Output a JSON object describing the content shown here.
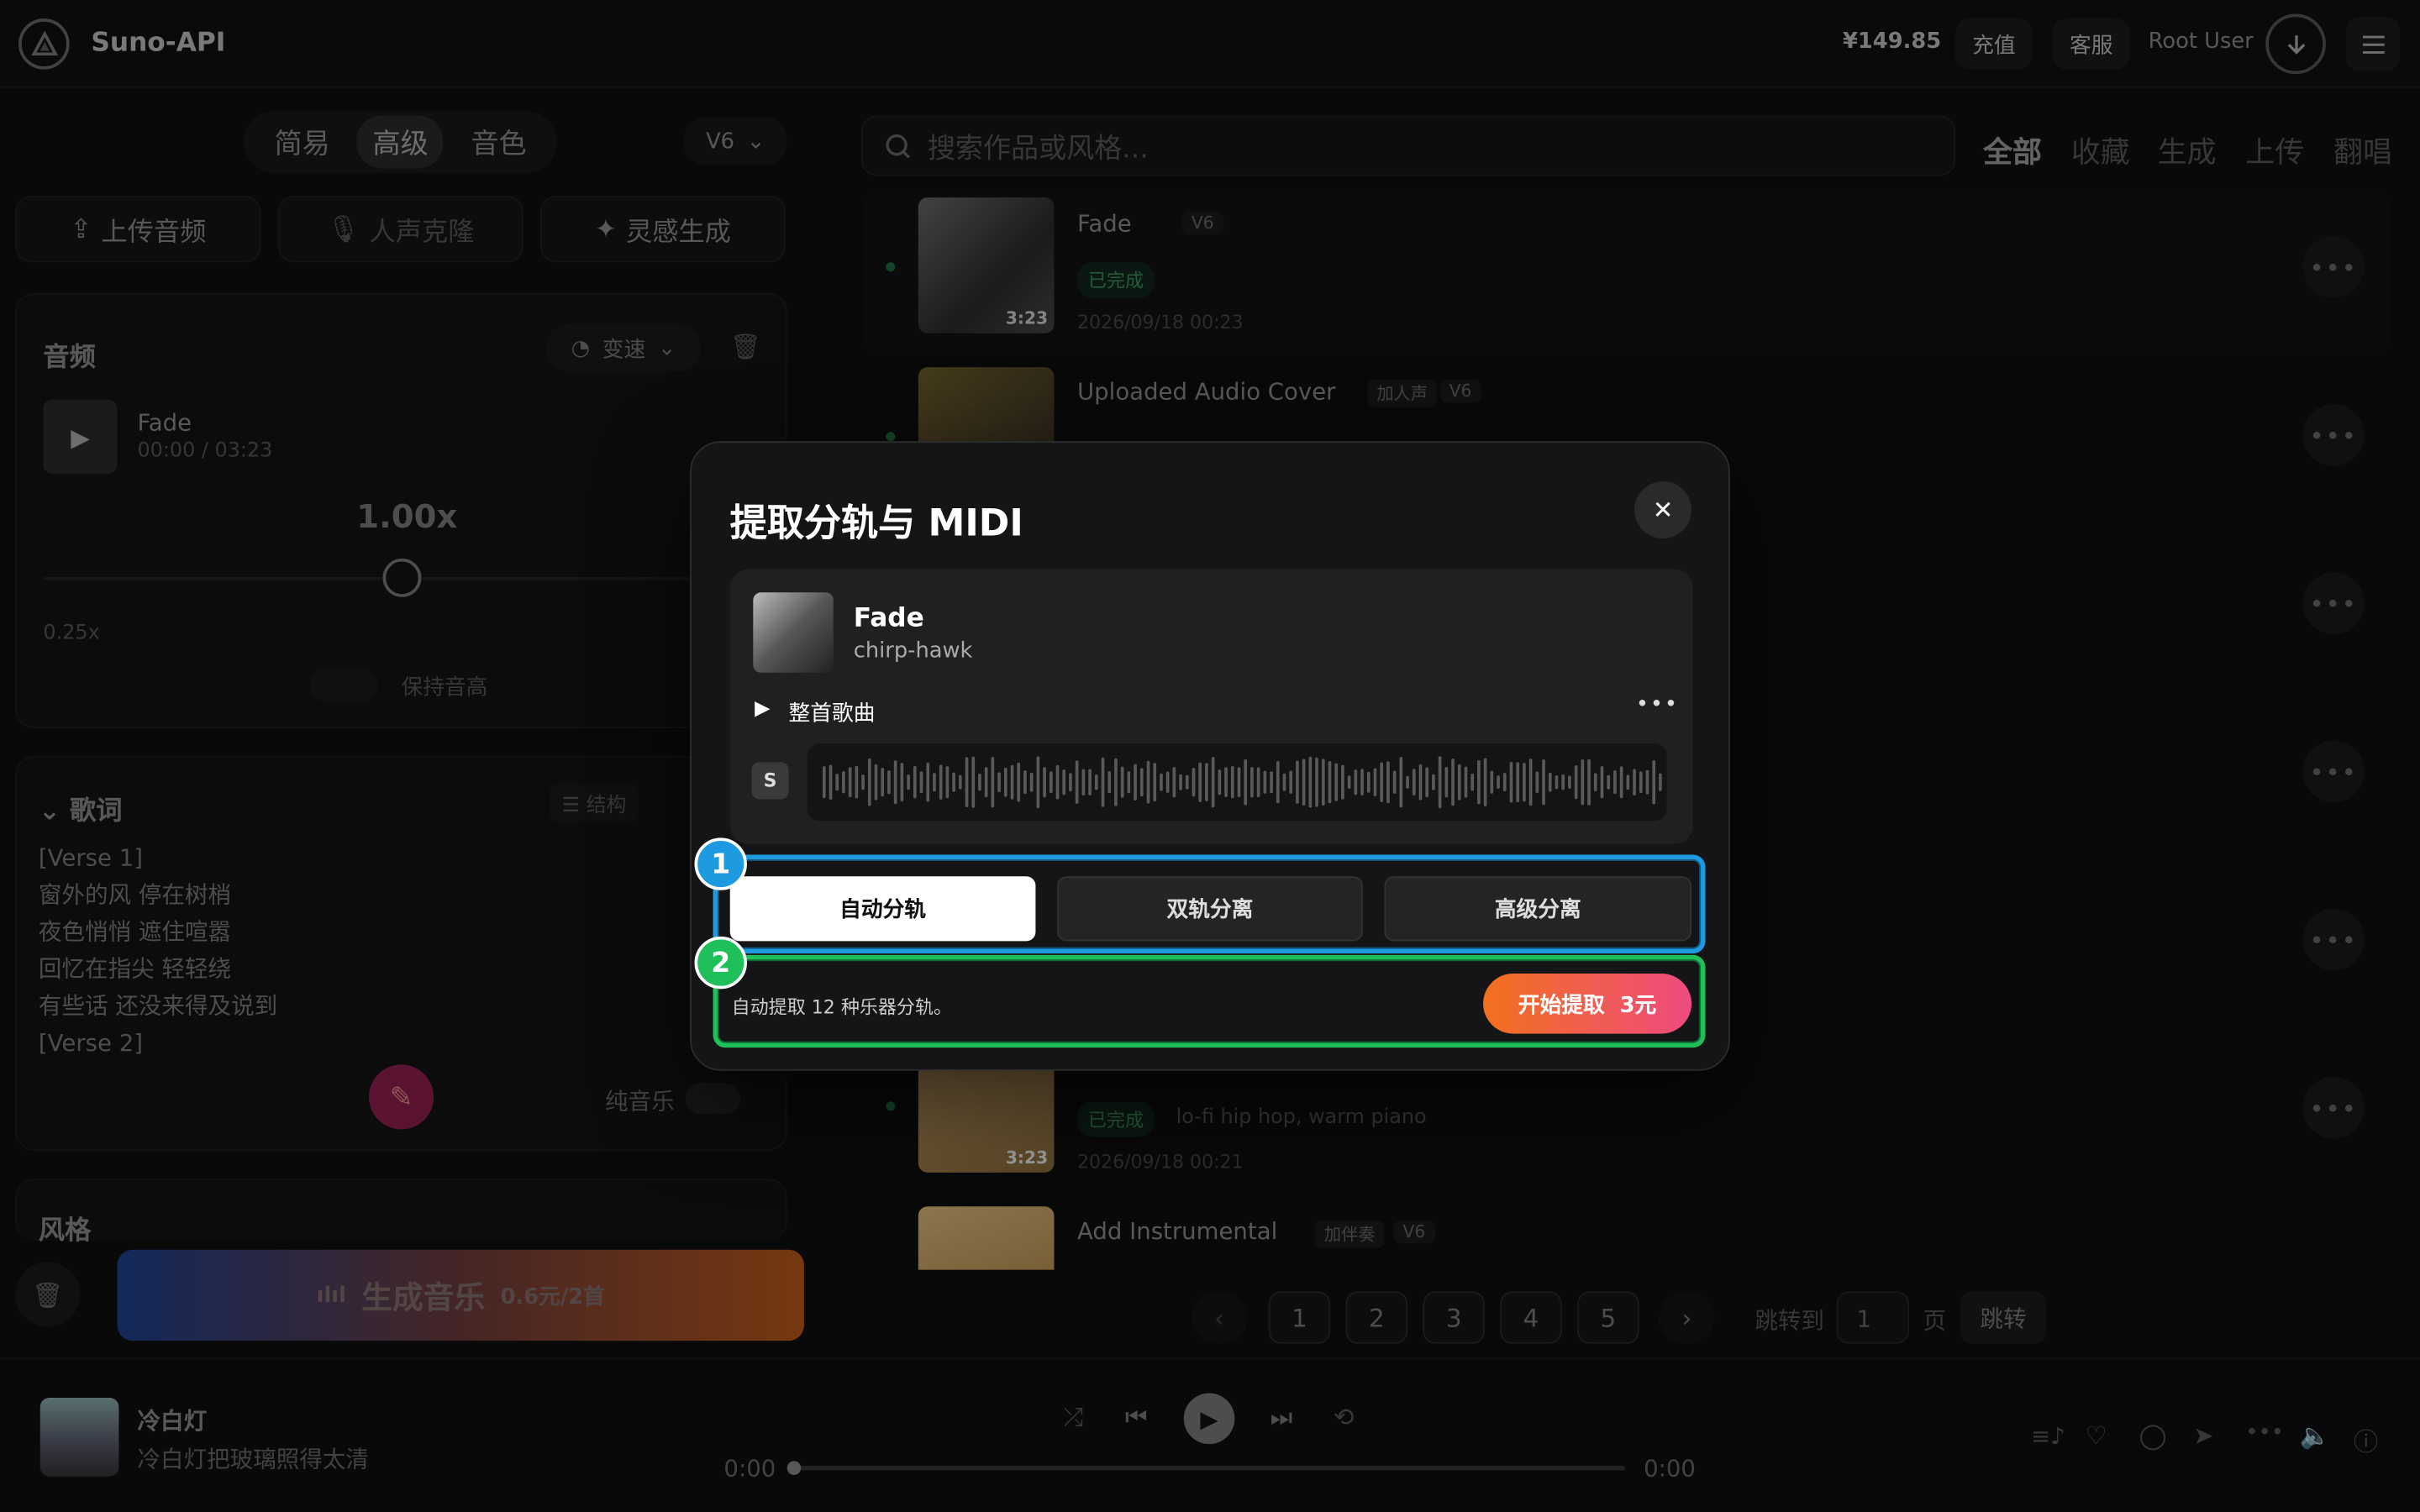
{
  "app": {
    "name": "Suno-API",
    "balance": "¥149.85",
    "recharge": "充值",
    "support": "客服",
    "user": "Root User"
  },
  "left": {
    "modes": [
      "简易",
      "高级",
      "音色"
    ],
    "active_mode": "高级",
    "version": "V6",
    "tools": {
      "upload": "上传音频",
      "clone": "人声克隆",
      "inspire": "灵感生成"
    },
    "audio": {
      "label": "音频",
      "speed_btn": "变速",
      "track": "Fade",
      "time": "00:00 / 03:23",
      "speed": "1.00x",
      "min": "0.25x",
      "keep_pitch": "保持音高"
    },
    "lyrics": {
      "label": "歌词",
      "structure": "结构",
      "lines": [
        "[Verse 1]",
        "窗外的风 停在树梢",
        "夜色悄悄 遮住喧嚣",
        "回忆在指尖 轻轻绕",
        "有些话 还没来得及说到",
        "[Verse 2]"
      ],
      "instrumental": "纯音乐"
    },
    "style_label": "风格",
    "generate": {
      "label": "生成音乐",
      "price": "0.6元/2首"
    }
  },
  "right": {
    "search_placeholder": "搜索作品或风格...",
    "filters": [
      "全部",
      "收藏",
      "生成",
      "上传",
      "翻唱"
    ],
    "songs": [
      {
        "title": "Fade",
        "chips": [
          "V6"
        ],
        "status": "已完成",
        "date": "2026/09/18 00:23",
        "duration": "3:23"
      },
      {
        "title": "Uploaded Audio Cover",
        "chips": [
          "加人声",
          "V6"
        ]
      },
      {
        "title": "",
        "status": "已完成",
        "style": "lo-fi hip hop, warm piano",
        "date": "2026/09/18 00:21",
        "duration": "3:23"
      },
      {
        "title": "Add Instrumental",
        "chips": [
          "加伴奏",
          "V6"
        ]
      }
    ],
    "pages": [
      "1",
      "2",
      "3",
      "4",
      "5"
    ],
    "jump_label": "跳转到",
    "jump_value": "1",
    "page_unit": "页",
    "jump_btn": "跳转"
  },
  "player": {
    "title": "冷白灯",
    "subtitle": "冷白灯把玻璃照得太清",
    "elapsed": "0:00",
    "total": "0:00"
  },
  "modal": {
    "title": "提取分轨与 MIDI",
    "track": "Fade",
    "artist": "chirp-hawk",
    "whole": "整首歌曲",
    "s_tag": "S",
    "options": [
      "自动分轨",
      "双轨分离",
      "高级分离"
    ],
    "active_option": "自动分轨",
    "desc": "自动提取 12 种乐器分轨。",
    "start": "开始提取",
    "price": "3元",
    "annotations": [
      "1",
      "2"
    ]
  },
  "colors": {
    "accent_orange": "#f2701e",
    "accent_pink": "#ee4b7f",
    "annot_blue": "#1e9be0",
    "annot_green": "#1fbf5a"
  }
}
